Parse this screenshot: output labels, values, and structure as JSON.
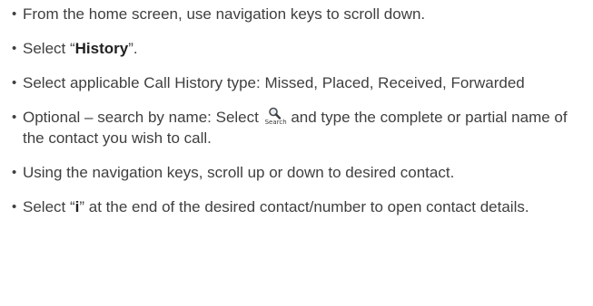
{
  "steps": [
    {
      "text": "From the home screen, use navigation keys to scroll down."
    },
    {
      "prefix": "Select “",
      "bold": "History",
      "suffix": "”."
    },
    {
      "text": "Select applicable Call History type: Missed, Placed, Received, Forwarded"
    },
    {
      "prefix": "Optional – search by name: Select ",
      "icon_name": "search-icon",
      "icon_label": "Search",
      "suffix": " and type the complete or partial name of the contact you wish to call."
    },
    {
      "text": "Using the navigation keys, scroll up or down to desired contact."
    },
    {
      "prefix": "Select “",
      "bold": "i",
      "suffix": "” at the end of the desired contact/number to open contact details."
    }
  ]
}
